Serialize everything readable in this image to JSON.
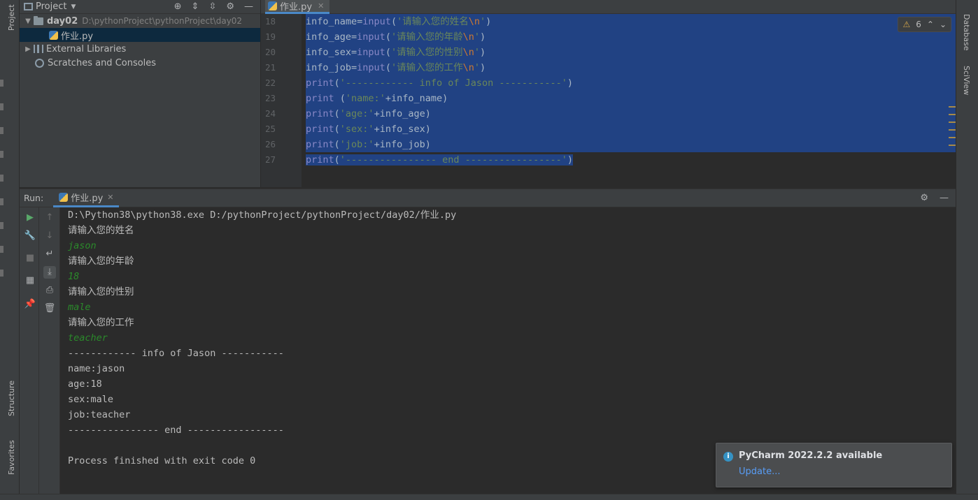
{
  "left_strip": {
    "project_tab": "Project",
    "structure_tab": "Structure",
    "favorites_tab": "Favorites"
  },
  "right_strip": {
    "database_tab": "Database",
    "sciview_tab": "SciView"
  },
  "project_panel": {
    "title": "Project",
    "tree": {
      "root_name": "day02",
      "root_path": "D:\\pythonProject\\pythonProject\\day02",
      "file": "作业.py",
      "external": "External Libraries",
      "scratches": "Scratches and Consoles"
    }
  },
  "editor": {
    "tab_label": "作业.py",
    "warnings_count": "6",
    "line_numbers": [
      "18",
      "19",
      "20",
      "21",
      "22",
      "23",
      "24",
      "25",
      "26",
      "27"
    ]
  },
  "run": {
    "label": "Run:",
    "tab_label": "作业.py",
    "console": [
      {
        "text": "D:\\Python38\\python38.exe D:/pythonProject/pythonProject/day02/作业.py",
        "kind": "normal"
      },
      {
        "text": "请输入您的姓名",
        "kind": "normal"
      },
      {
        "text": "jason",
        "kind": "input"
      },
      {
        "text": "请输入您的年龄",
        "kind": "normal"
      },
      {
        "text": "18",
        "kind": "input"
      },
      {
        "text": "请输入您的性别",
        "kind": "normal"
      },
      {
        "text": "male",
        "kind": "input"
      },
      {
        "text": "请输入您的工作",
        "kind": "normal"
      },
      {
        "text": "teacher",
        "kind": "input"
      },
      {
        "text": "------------ info of Jason -----------",
        "kind": "normal"
      },
      {
        "text": "name:jason",
        "kind": "normal"
      },
      {
        "text": "age:18",
        "kind": "normal"
      },
      {
        "text": "sex:male",
        "kind": "normal"
      },
      {
        "text": "job:teacher",
        "kind": "normal"
      },
      {
        "text": "---------------- end -----------------",
        "kind": "normal"
      },
      {
        "text": "",
        "kind": "normal"
      },
      {
        "text": "Process finished with exit code 0",
        "kind": "normal"
      }
    ]
  },
  "notification": {
    "title": "PyCharm 2022.2.2 available",
    "link": "Update..."
  },
  "colors": {
    "selection": "#214283",
    "string": "#6a8759",
    "builtin": "#8888c6",
    "escape": "#cc7832",
    "console_input": "#2b8a2b"
  }
}
